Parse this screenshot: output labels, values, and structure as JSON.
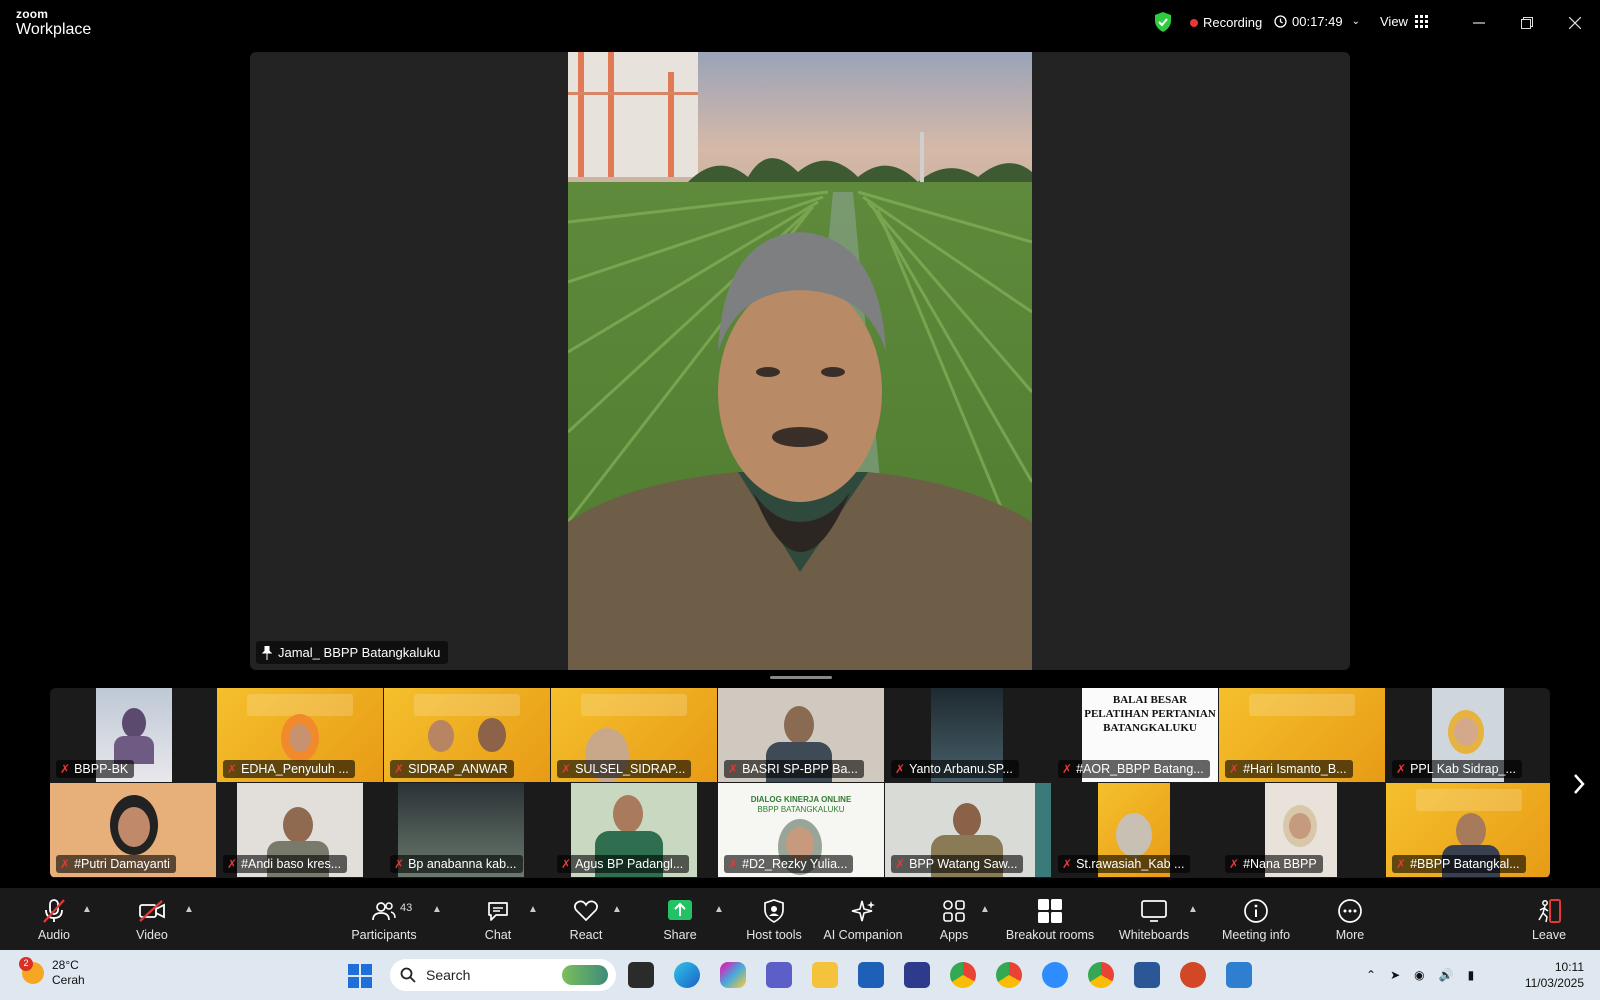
{
  "app": {
    "brand_top": "zoom",
    "brand_bottom": "Workplace"
  },
  "titlebar": {
    "recording_label": "Recording",
    "timer": "00:17:49",
    "view_label": "View"
  },
  "stage": {
    "speaker_name": "Jamal_ BBPP Batangkaluku"
  },
  "gallery": {
    "row1": [
      "BBPP-BK",
      "EDHA_Penyuluh ...",
      "SIDRAP_ANWAR",
      "SULSEL_SIDRAP...",
      "BASRI SP-BPP Ba...",
      "Yanto Arbanu.SP...",
      "#AOR_BBPP Batang...",
      "#Hari Ismanto_B...",
      "PPL Kab Sidrap_..."
    ],
    "row2": [
      "#Putri Damayanti",
      "#Andi baso kres...",
      "Bp anabanna kab...",
      "Agus BP Padangl...",
      "#D2_Rezky Yulia...",
      "BPP Watang Saw...",
      "St.rawasiah_Kab ...",
      "#Nana BBPP",
      "#BBPP Batangkal..."
    ],
    "slide_text_1": "BALAI BESAR",
    "slide_text_2": "PELATIHAN PERTANIAN",
    "slide_text_3": "BATANGKALUKU",
    "dialog_text_1": "DIALOG KINERJA ONLINE",
    "dialog_text_2": "BBPP BATANGKALUKU"
  },
  "toolbar": {
    "audio": "Audio",
    "video": "Video",
    "participants": "Participants",
    "participants_count": "43",
    "chat": "Chat",
    "react": "React",
    "share": "Share",
    "host_tools": "Host tools",
    "ai_companion": "AI Companion",
    "apps": "Apps",
    "breakout_rooms": "Breakout rooms",
    "whiteboards": "Whiteboards",
    "meeting_info": "Meeting info",
    "more": "More",
    "leave": "Leave"
  },
  "taskbar": {
    "weather_temp": "28°C",
    "weather_desc": "Cerah",
    "weather_badge": "2",
    "search_placeholder": "Search",
    "time": "10:11",
    "date": "11/03/2025"
  },
  "colors": {
    "recording_red": "#e53935",
    "shield_green": "#2ecc40",
    "share_green": "#23c264",
    "leave_red": "#e53935"
  }
}
